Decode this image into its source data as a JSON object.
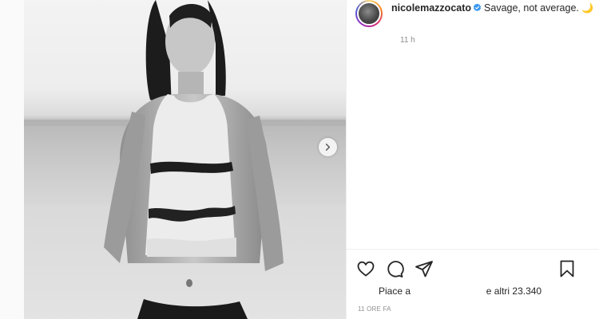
{
  "post": {
    "username": "nicolemazzocato",
    "caption_text": "Savage, not average.",
    "caption_emoji": "🌙",
    "timestamp": "11 h",
    "likes_prefix": "Piace a",
    "likes_suffix": "e altri 23.340",
    "post_time": "11 ORE FA"
  },
  "icons": {
    "verified": "verified-badge-icon",
    "like": "heart-icon",
    "comment": "comment-icon",
    "share": "paper-plane-icon",
    "save": "bookmark-icon",
    "next": "chevron-right-icon"
  },
  "colors": {
    "accent": "#3897f0",
    "text": "#262626",
    "secondary": "#8e8e8e"
  }
}
